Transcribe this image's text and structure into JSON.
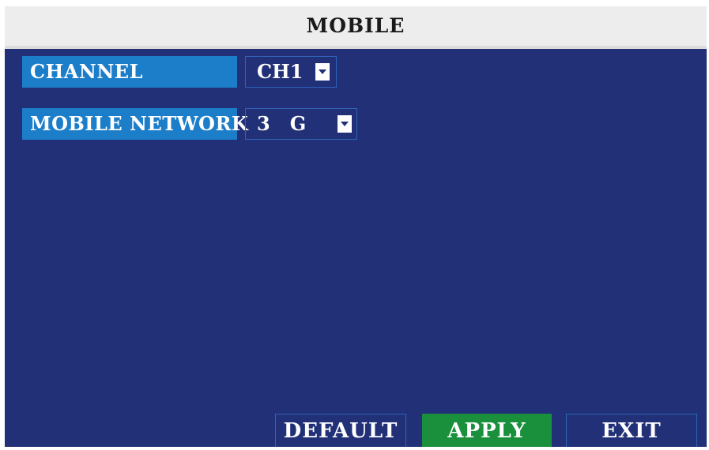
{
  "window": {
    "title": "MOBILE"
  },
  "settings": {
    "channel": {
      "label": "CHANNEL",
      "value": "CH1"
    },
    "mobile_network": {
      "label": "MOBILE NETWORK",
      "value": "3   G"
    }
  },
  "buttons": {
    "default_label": "DEFAULT",
    "apply_label": "APPLY",
    "exit_label": "EXIT"
  },
  "colors": {
    "panel_background": "#223077",
    "label_background": "#1c7ec9",
    "apply_active": "#1a8f3c",
    "titlebar_background": "#ededed"
  },
  "icons": {
    "dropdown": "chevron-down-icon"
  }
}
